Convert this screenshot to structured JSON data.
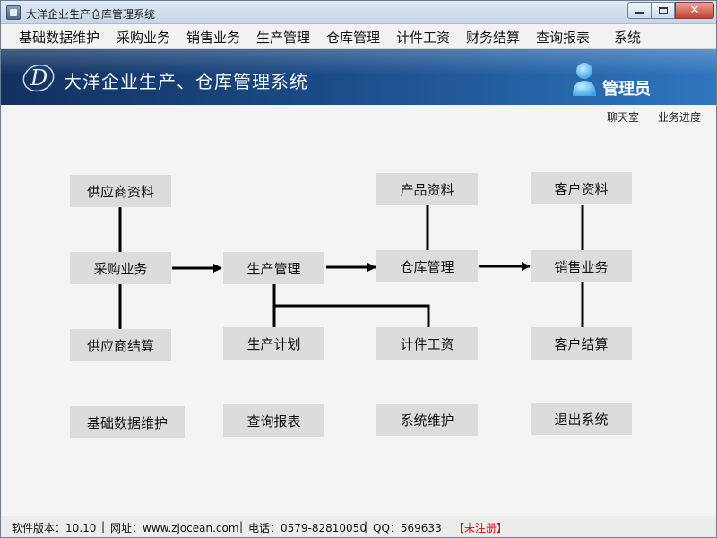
{
  "window": {
    "title": "大洋企业生产仓库管理系统",
    "controls": {
      "minimize": "minimize-icon",
      "maximize": "maximize-icon",
      "close": "✕"
    }
  },
  "menu": [
    "基础数据维护",
    "采购业务",
    "销售业务",
    "生产管理",
    "仓库管理",
    "计件工资",
    "财务结算",
    "查询报表",
    "系统"
  ],
  "banner": {
    "logo_letter": "D",
    "title": "大洋企业生产、仓库管理系统",
    "user": "管理员"
  },
  "links": {
    "chat": "聊天室",
    "progress": "业务进度"
  },
  "flow": {
    "supplier_info": "供应商资料",
    "purchase": "采购业务",
    "supplier_settle": "供应商结算",
    "production": "生产管理",
    "production_plan": "生产计划",
    "product_info": "产品资料",
    "warehouse": "仓库管理",
    "piece_wage": "计件工资",
    "customer_info": "客户资料",
    "sales": "销售业务",
    "customer_settle": "客户结算"
  },
  "bottom": {
    "base_data": "基础数据维护",
    "query": "查询报表",
    "sys_maint": "系统维护",
    "exit": "退出系统"
  },
  "status": {
    "version": "软件版本：10.10",
    "sep1": "|",
    "website": "网址：www.zjocean.com",
    "sep2": "|",
    "phone": "电话：0579-82810050",
    "sep3": "|",
    "qq": "QQ：569633",
    "registration": "【未注册】"
  },
  "colors": {
    "banner_dark": "#12315f",
    "banner_light": "#2f76bf",
    "node_bg": "#dcdcdc",
    "unregistered": "#d01010"
  }
}
